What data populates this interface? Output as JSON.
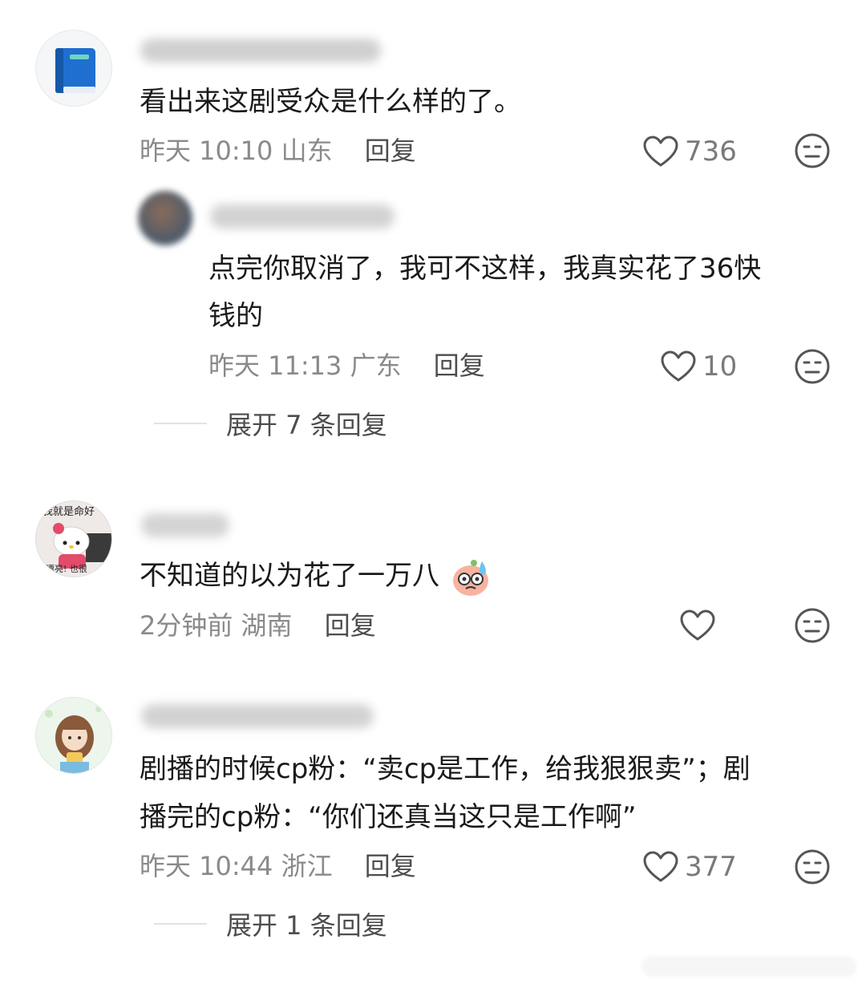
{
  "comments": [
    {
      "text": "看出来这剧受众是什么样的了。",
      "time": "昨天 10:10",
      "location": "山东",
      "reply_label": "回复",
      "likes": "736",
      "avatar_icon": "book-icon",
      "sub_reply": {
        "text_line1": "点完你取消了，我可不这样，我真实花了36快",
        "text_line2": "钱的",
        "time": "昨天 11:13",
        "location": "广东",
        "reply_label": "回复",
        "likes": "10"
      },
      "expand_label": "展开 7 条回复"
    },
    {
      "text": "不知道的以为花了一万八",
      "emoji_icon": "sweat-face-emoji-icon",
      "time": "2分钟前",
      "location": "湖南",
      "reply_label": "回复",
      "likes": "",
      "avatar_caption_top": "我就是命好",
      "avatar_caption_bottom": "漂亮! 也很"
    },
    {
      "text_line1": "剧播的时候cp粉：“卖cp是工作，给我狠狠卖”；剧",
      "text_line2": "播完的cp粉：“你们还真当这只是工作啊”",
      "time": "昨天 10:44",
      "location": "浙江",
      "reply_label": "回复",
      "likes": "377",
      "expand_label": "展开 1 条回复"
    }
  ],
  "colors": {
    "text": "#1a1a1a",
    "meta": "#8a8a8a",
    "reply": "#4d4d4d",
    "icon_stroke": "#555555",
    "book_blue": "#1e6fd0"
  }
}
